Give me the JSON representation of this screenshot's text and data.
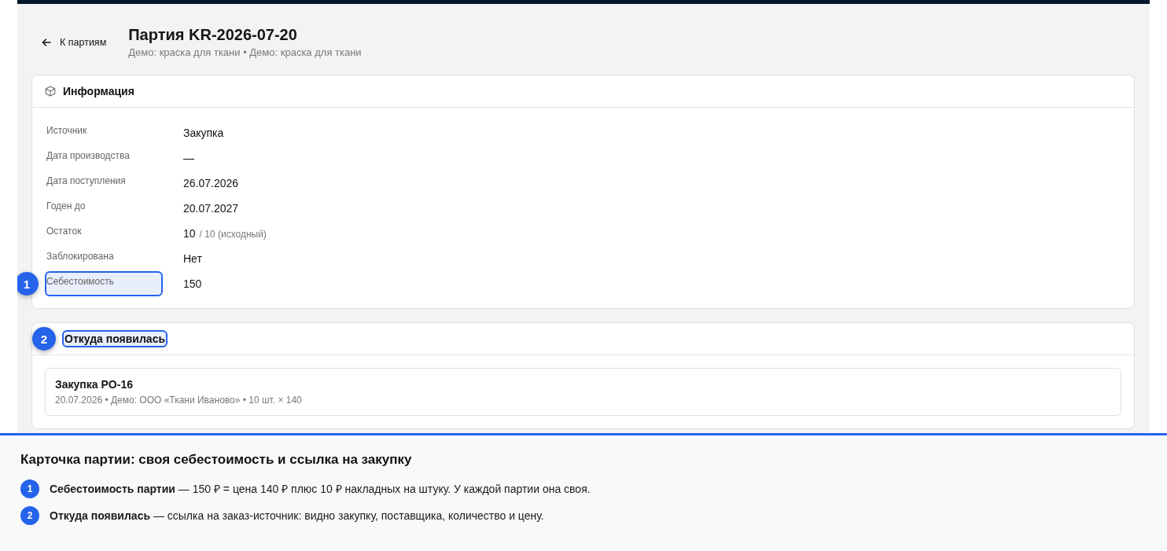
{
  "header": {
    "back_link": "К партиям",
    "title": "Партия KR-2026-07-20",
    "subtitle": "Демо: краска для ткани • Демо: краска для ткани"
  },
  "info_card": {
    "title": "Информация",
    "fields": [
      {
        "label": "Источник",
        "value": "Закупка",
        "highlighted": false
      },
      {
        "label": "Дата производства",
        "value": "—",
        "highlighted": false
      },
      {
        "label": "Дата поступления",
        "value": "26.07.2026",
        "highlighted": false
      },
      {
        "label": "Годен до",
        "value": "20.07.2027",
        "highlighted": false
      },
      {
        "label": "Остаток",
        "value": "10",
        "note": "/ 10 (исходный)",
        "highlighted": false
      },
      {
        "label": "Заблокирована",
        "value": "Нет",
        "highlighted": false
      },
      {
        "label": "Себестоимость",
        "value": "150",
        "highlighted": true,
        "marker": "1"
      }
    ]
  },
  "origin_card": {
    "title": "Откуда появилась",
    "highlighted": true,
    "marker": "2",
    "items": [
      {
        "title": "Закупка PO-16",
        "details": "20.07.2026 • Демо: ООО «Ткани Иваново» • 10 шт. × 140"
      }
    ]
  },
  "callout": {
    "title": "Карточка партии: своя себестоимость и ссылка на закупку",
    "notes": [
      {
        "marker": "1",
        "text": "**Себестоимость партии** — 150 ₽ = цена 140 ₽ плюс 10 ₽ накладных на штуку. У каждой партии она своя."
      },
      {
        "marker": "2",
        "text": "**Откуда появилась** — ссылка на заказ-источник: видно закупку, поставщика, количество и цену."
      }
    ]
  }
}
